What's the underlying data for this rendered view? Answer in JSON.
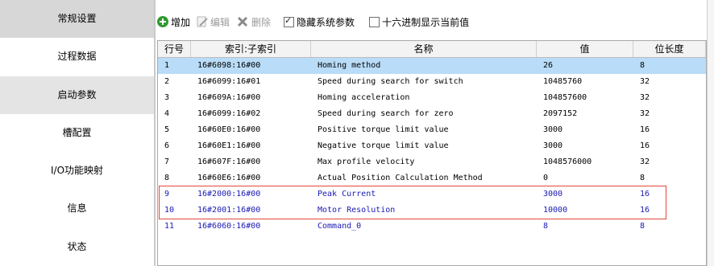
{
  "sidebar": {
    "items": [
      {
        "label": "常规设置",
        "selected": true
      },
      {
        "label": "过程数据"
      },
      {
        "label": "启动参数"
      },
      {
        "label": "槽配置"
      },
      {
        "label": "I/O功能映射"
      },
      {
        "label": "信息"
      },
      {
        "label": "状态"
      }
    ]
  },
  "toolbar": {
    "add_label": "增加",
    "edit_label": "编辑",
    "delete_label": "删除",
    "hide_system_params_label": "隐藏系统参数",
    "hide_system_params_checked": true,
    "hex_display_label": "十六进制显示当前值",
    "hex_display_checked": false
  },
  "table": {
    "headers": [
      "行号",
      "索引:子索引",
      "名称",
      "值",
      "位长度"
    ],
    "rows": [
      [
        "1",
        "16#6098:16#00",
        "Homing method",
        "26",
        "8"
      ],
      [
        "2",
        "16#6099:16#01",
        "Speed during search for switch",
        "10485760",
        "32"
      ],
      [
        "3",
        "16#609A:16#00",
        "Homing acceleration",
        "104857600",
        "32"
      ],
      [
        "4",
        "16#6099:16#02",
        "Speed during search for zero",
        "2097152",
        "32"
      ],
      [
        "5",
        "16#60E0:16#00",
        "Positive torque limit value",
        "3000",
        "16"
      ],
      [
        "6",
        "16#60E1:16#00",
        "Negative torque limit value",
        "3000",
        "16"
      ],
      [
        "7",
        "16#607F:16#00",
        "Max profile velocity",
        "1048576000",
        "32"
      ],
      [
        "8",
        "16#60E6:16#00",
        "Actual Position Calculation Method",
        "0",
        "8"
      ],
      [
        "9",
        "16#2000:16#00",
        "Peak Current",
        "3000",
        "16"
      ],
      [
        "10",
        "16#2001:16#00",
        "Motor Resolution",
        "10000",
        "16"
      ],
      [
        "11",
        "16#6060:16#00",
        "Command_0",
        "8",
        "8"
      ]
    ]
  },
  "colors": {
    "selected_row": "#b9dcf8",
    "user_param_text": "#1a1ab4",
    "highlight_border": "#e0483a",
    "add_icon": "#2f9a2f"
  }
}
